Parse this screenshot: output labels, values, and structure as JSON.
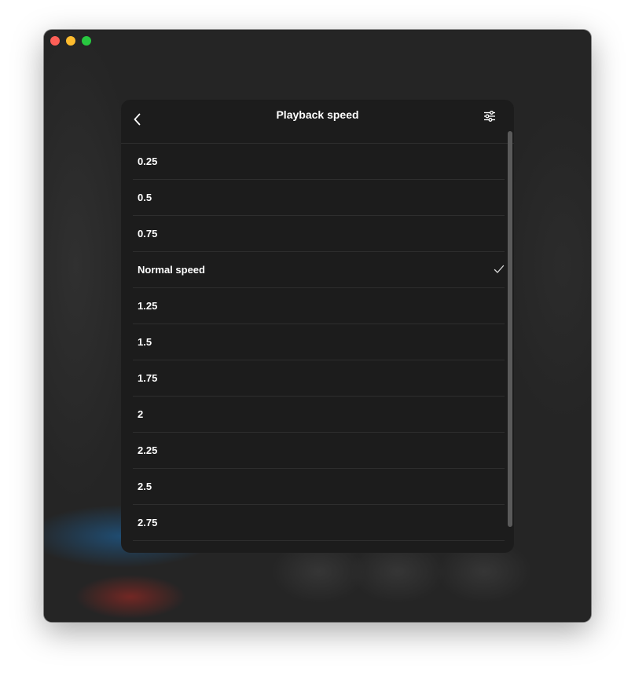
{
  "panel": {
    "title": "Playback speed"
  },
  "speeds": [
    {
      "label": "0.25",
      "selected": false
    },
    {
      "label": "0.5",
      "selected": false
    },
    {
      "label": "0.75",
      "selected": false
    },
    {
      "label": "Normal speed",
      "selected": true
    },
    {
      "label": "1.25",
      "selected": false
    },
    {
      "label": "1.5",
      "selected": false
    },
    {
      "label": "1.75",
      "selected": false
    },
    {
      "label": "2",
      "selected": false
    },
    {
      "label": "2.25",
      "selected": false
    },
    {
      "label": "2.5",
      "selected": false
    },
    {
      "label": "2.75",
      "selected": false
    }
  ],
  "icons": {
    "back": "chevron-left-icon",
    "settings": "sliders-icon",
    "selected": "checkmark-icon"
  },
  "colors": {
    "window_close": "#fe5f57",
    "window_minimize": "#febc2e",
    "window_zoom": "#28c840",
    "panel_background": "#1c1c1c",
    "text": "#ffffff"
  }
}
